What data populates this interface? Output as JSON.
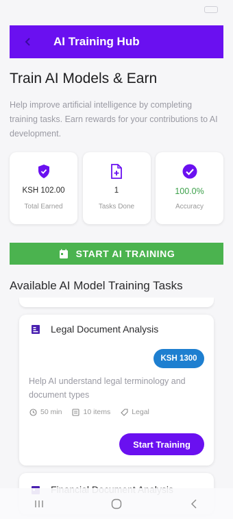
{
  "app": {
    "title": "AI Training Hub"
  },
  "hero": {
    "title": "Train AI Models & Earn",
    "description": "Help improve artificial intelligence by completing training tasks. Earn rewards for your contributions to AI development."
  },
  "stats": [
    {
      "icon": "shield-icon",
      "value": "KSH 102.00",
      "label": "Total Earned"
    },
    {
      "icon": "file-plus-icon",
      "value": "1",
      "label": "Tasks Done"
    },
    {
      "icon": "check-circle-icon",
      "value": "100.0%",
      "label": "Accuracy"
    }
  ],
  "start_button": {
    "label": "START AI TRAINING",
    "icon": "calendar-icon"
  },
  "section_title": "Available AI Model Training Tasks",
  "tasks": [
    {
      "icon": "document-icon",
      "title": "Legal Document Analysis",
      "price": "KSH 1300",
      "description": "Help AI understand legal terminology and document types",
      "duration": "50 min",
      "items": "10 items",
      "category": "Legal",
      "button": "Start Training"
    },
    {
      "icon": "calendar-icon",
      "title": "Financial Document Analysis"
    }
  ],
  "colors": {
    "primary": "#6a10f0",
    "success": "#4bb34f",
    "badge": "#1e7fd0",
    "accuracy": "#3ca04a"
  }
}
